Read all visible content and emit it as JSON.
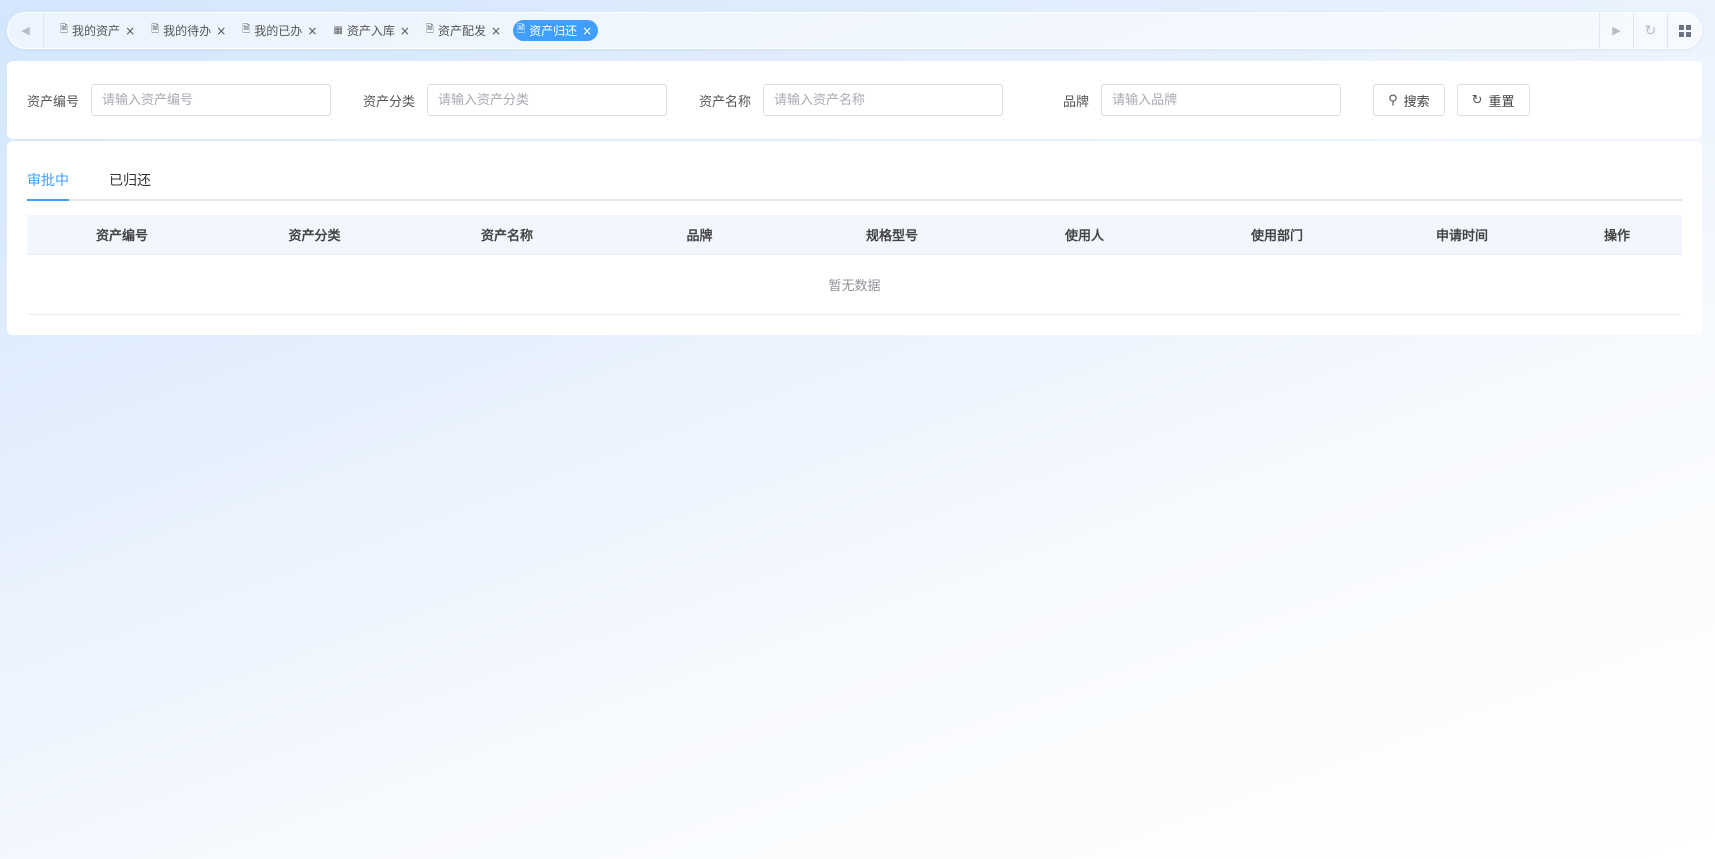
{
  "tabs": [
    {
      "label": "我的资产",
      "icon": "document-icon"
    },
    {
      "label": "我的待办",
      "icon": "document-icon"
    },
    {
      "label": "我的已办",
      "icon": "document-icon"
    },
    {
      "label": "资产入库",
      "icon": "table-icon"
    },
    {
      "label": "资产配发",
      "icon": "document-icon"
    },
    {
      "label": "资产归还",
      "icon": "document-icon",
      "active": true
    }
  ],
  "search": {
    "asset_no": {
      "label": "资产编号",
      "placeholder": "请输入资产编号"
    },
    "asset_category": {
      "label": "资产分类",
      "placeholder": "请输入资产分类"
    },
    "asset_name": {
      "label": "资产名称",
      "placeholder": "请输入资产名称"
    },
    "brand": {
      "label": "品牌",
      "placeholder": "请输入品牌"
    },
    "search_label": "搜索",
    "reset_label": "重置"
  },
  "subtabs": [
    {
      "label": "审批中",
      "active": true
    },
    {
      "label": "已归还"
    }
  ],
  "table": {
    "columns": [
      "资产编号",
      "资产分类",
      "资产名称",
      "品牌",
      "规格型号",
      "使用人",
      "使用部门",
      "申请时间",
      "操作"
    ],
    "empty_text": "暂无数据"
  },
  "colors": {
    "accent": "#409eff"
  }
}
